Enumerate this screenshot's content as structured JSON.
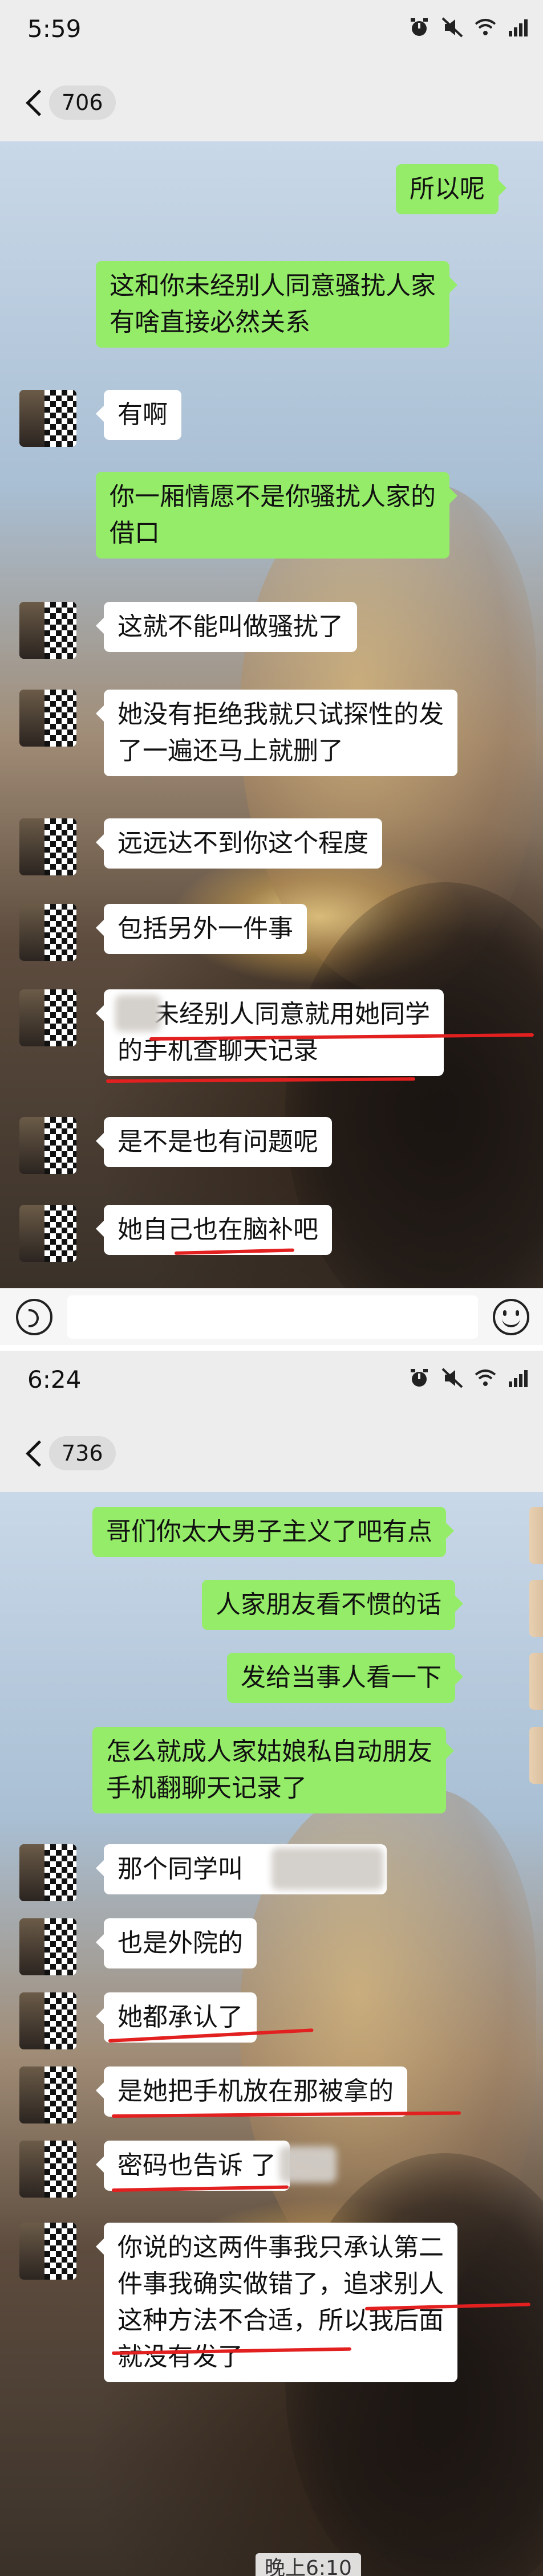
{
  "screen1": {
    "status_time": "5:59",
    "unread_count": "706",
    "messages": [
      {
        "side": "right",
        "text": "所以呢"
      },
      {
        "side": "right",
        "lines": [
          "这和你未经别人同意骚扰人家",
          "有啥直接必然关系"
        ]
      },
      {
        "side": "left",
        "text": "有啊"
      },
      {
        "side": "right",
        "lines": [
          "你一厢情愿不是你骚扰人家的",
          "借口"
        ]
      },
      {
        "side": "left",
        "text": "这就不能叫做骚扰了"
      },
      {
        "side": "left",
        "lines": [
          "她没有拒绝我就只试探性的发",
          "了一遍还马上就删了"
        ]
      },
      {
        "side": "left",
        "text": "远远达不到你这个程度"
      },
      {
        "side": "left",
        "text": "包括另外一件事"
      },
      {
        "side": "left",
        "lines": [
          "未经别人同意就用她同学",
          "的手机查聊天记录"
        ]
      },
      {
        "side": "left",
        "text": "是不是也有问题呢"
      },
      {
        "side": "left",
        "text": "她自己也在脑补吧"
      }
    ]
  },
  "screen2": {
    "status_time": "6:24",
    "unread_count": "736",
    "messages": [
      {
        "side": "right",
        "text": "哥们你太大男子主义了吧有点"
      },
      {
        "side": "right",
        "text": "人家朋友看不惯的话"
      },
      {
        "side": "right",
        "text": "发给当事人看一下"
      },
      {
        "side": "right",
        "lines": [
          "怎么就成人家姑娘私自动朋友",
          "手机翻聊天记录了"
        ]
      },
      {
        "side": "left",
        "text": "那个同学叫"
      },
      {
        "side": "left",
        "text": "也是外院的"
      },
      {
        "side": "left",
        "text": "她都承认了"
      },
      {
        "side": "left",
        "text": "是她把手机放在那被拿的"
      },
      {
        "side": "left",
        "text": "密码也告诉          了"
      },
      {
        "side": "left",
        "lines": [
          "你说的这两件事我只承认第二",
          "件事我确实做错了，追求别人",
          "这种方法不合适，所以我后面",
          "就没有发了"
        ]
      }
    ],
    "time_separator": "晚上6:10"
  },
  "colors": {
    "bubble_right": "#95ec69",
    "bubble_left": "#ffffff",
    "underline": "#e32020",
    "app_bg": "#ededed"
  },
  "icons": [
    "back-arrow-icon",
    "alarm-icon",
    "mute-icon",
    "wifi-icon",
    "signal-icon",
    "voice-icon",
    "emoji-icon"
  ]
}
